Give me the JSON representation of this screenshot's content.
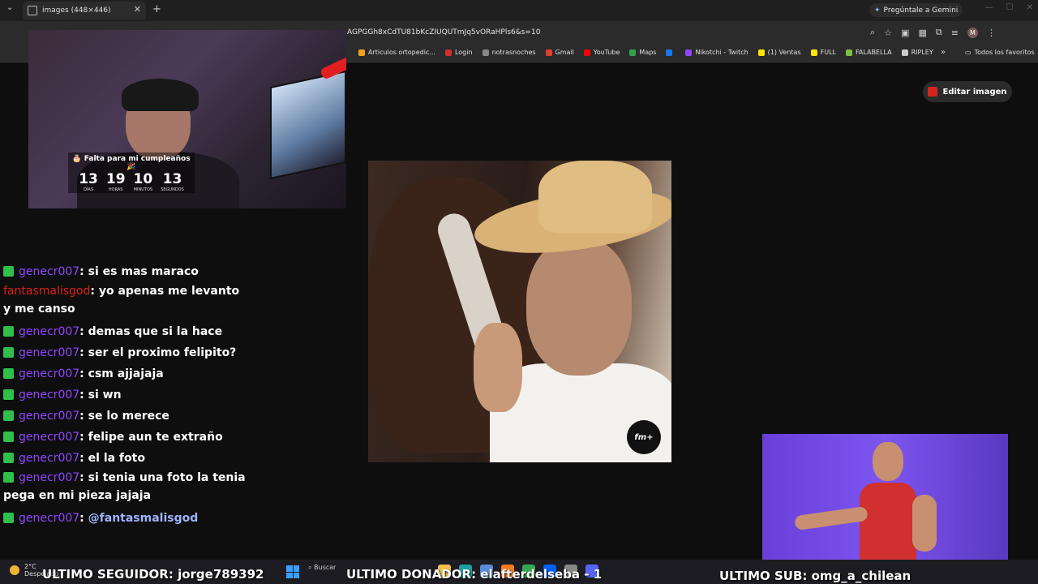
{
  "browser": {
    "tab_title": "images (448×446)",
    "url": "AGPGGh8xCdTU81bKcZIUQUTmJq5vORaHPls6&s=10",
    "gemini_label": "Pregúntale a Gemini",
    "profile_initial": "M",
    "bookmarks": [
      {
        "label": "Articulos ortopedic...",
        "color": "#f0a020"
      },
      {
        "label": "Login",
        "color": "#d03030"
      },
      {
        "label": "notrasnoches",
        "color": "#888888"
      },
      {
        "label": "Gmail",
        "color": "#e04030"
      },
      {
        "label": "YouTube",
        "color": "#ff0000"
      },
      {
        "label": "Maps",
        "color": "#30a050"
      },
      {
        "label": "",
        "color": "#1877f2"
      },
      {
        "label": "Nikotchi - Twitch",
        "color": "#9146ff"
      },
      {
        "label": "(1) Ventas",
        "color": "#ffe600"
      },
      {
        "label": "FULL",
        "color": "#ffe600"
      },
      {
        "label": "FALABELLA",
        "color": "#7fbf3f"
      },
      {
        "label": "RIPLEY",
        "color": "#cccccc"
      }
    ],
    "all_favorites": "Todos los favoritos"
  },
  "edit_button": "Editar imagen",
  "countdown": {
    "title": "🎂 Falta para mi cumpleaños 🎉",
    "units": [
      {
        "value": "13",
        "label": "DÍAS"
      },
      {
        "value": "19",
        "label": "HORAS"
      },
      {
        "value": "10",
        "label": "MINUTOS"
      },
      {
        "value": "13",
        "label": "SEGUNDOS"
      }
    ]
  },
  "radio_logo": "fm+",
  "chat": [
    {
      "user": "genecr007",
      "user_color": "purple",
      "badge": true,
      "text": ": si es mas maraco"
    },
    {
      "user": "fantasmalisgod",
      "user_color": "red",
      "badge": false,
      "text": ": yo apenas me levanto y me canso"
    },
    {
      "user": "genecr007",
      "user_color": "purple",
      "badge": true,
      "text": ": demas que si la hace"
    },
    {
      "user": "genecr007",
      "user_color": "purple",
      "badge": true,
      "text": ": ser el proximo felipito?"
    },
    {
      "user": "genecr007",
      "user_color": "purple",
      "badge": true,
      "text": ": csm ajjajaja"
    },
    {
      "user": "genecr007",
      "user_color": "purple",
      "badge": true,
      "text": ": si wn"
    },
    {
      "user": "genecr007",
      "user_color": "purple",
      "badge": true,
      "text": ": se lo merece"
    },
    {
      "user": "genecr007",
      "user_color": "purple",
      "badge": true,
      "text": ": felipe aun te extraño"
    },
    {
      "user": "genecr007",
      "user_color": "purple",
      "badge": true,
      "text": ": el la foto"
    },
    {
      "user": "genecr007",
      "user_color": "purple",
      "badge": true,
      "text": ": si tenia una foto la tenia pega en mi pieza jajaja"
    },
    {
      "user": "genecr007",
      "user_color": "purple",
      "badge": true,
      "text": ": ",
      "mention": "@fantasmalisgod"
    }
  ],
  "taskbar": {
    "weather_temp": "2°C",
    "weather_desc": "Despejado",
    "search_placeholder": "Buscar"
  },
  "tickers": {
    "follower": "ULTIMO SEGUIDOR: jorge789392",
    "donor": "ULTIMO DONADOR: elafterdelseba - 1",
    "sub": "ULTIMO SUB: omg_a_chilean"
  }
}
